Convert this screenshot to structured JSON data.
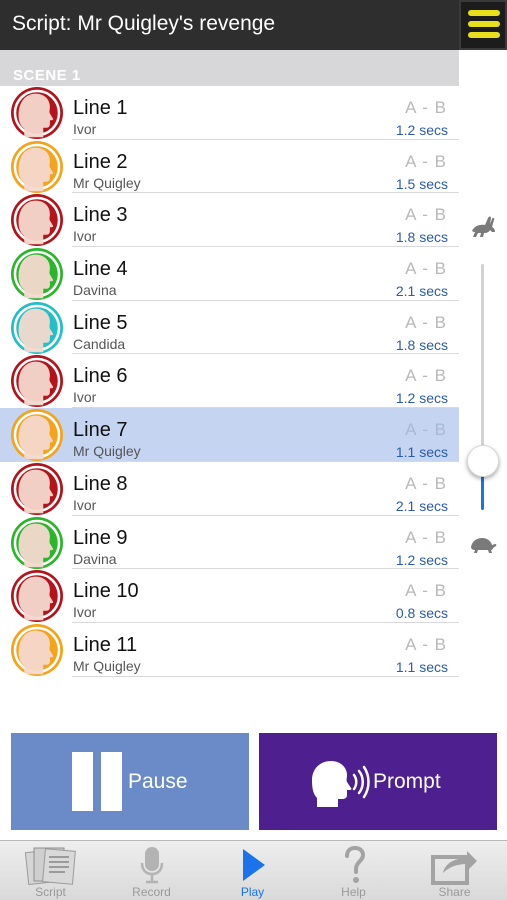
{
  "header": {
    "title": "Script:  Mr Quigley's revenge",
    "menu_icon": "hamburger-menu-icon",
    "menu_color": "#e9e01d"
  },
  "scene": {
    "label": "SCENE 1"
  },
  "speakers": {
    "Ivor": "#b3141b",
    "Mr Quigley": "#f4a31c",
    "Davina": "#2bb52b",
    "Candida": "#23bfc7"
  },
  "lines": [
    {
      "title": "Line 1",
      "speaker": "Ivor",
      "ab": "A  -  B",
      "duration": "1.2 secs"
    },
    {
      "title": "Line 2",
      "speaker": "Mr Quigley",
      "ab": "A  -  B",
      "duration": "1.5 secs"
    },
    {
      "title": "Line 3",
      "speaker": "Ivor",
      "ab": "A  -  B",
      "duration": "1.8 secs"
    },
    {
      "title": "Line 4",
      "speaker": "Davina",
      "ab": "A  -  B",
      "duration": "2.1 secs"
    },
    {
      "title": "Line 5",
      "speaker": "Candida",
      "ab": "A  -  B",
      "duration": "1.8 secs"
    },
    {
      "title": "Line 6",
      "speaker": "Ivor",
      "ab": "A  -  B",
      "duration": "1.2 secs"
    },
    {
      "title": "Line 7",
      "speaker": "Mr Quigley",
      "ab": "A  -  B",
      "duration": "1.1 secs",
      "selected": true
    },
    {
      "title": "Line 8",
      "speaker": "Ivor",
      "ab": "A  -  B",
      "duration": "2.1 secs"
    },
    {
      "title": "Line 9",
      "speaker": "Davina",
      "ab": "A  -  B",
      "duration": "1.2 secs"
    },
    {
      "title": "Line 10",
      "speaker": "Ivor",
      "ab": "A  -  B",
      "duration": "0.8 secs"
    },
    {
      "title": "Line 11",
      "speaker": "Mr Quigley",
      "ab": "A  -  B",
      "duration": "1.1 secs"
    }
  ],
  "speed_slider": {
    "fast_icon": "rabbit-icon",
    "slow_icon": "turtle-icon",
    "level": 0.2
  },
  "controls": {
    "pause_label": "Pause",
    "pause_icon": "pause-icon",
    "pause_color": "#6a8bc8",
    "prompt_label": "Prompt",
    "prompt_icon": "speaking-head-icon",
    "prompt_color": "#4d1f8f"
  },
  "tabs": [
    {
      "label": "Script",
      "icon": "script-pages-icon",
      "active": false
    },
    {
      "label": "Record",
      "icon": "microphone-icon",
      "active": false
    },
    {
      "label": "Play",
      "icon": "play-icon",
      "active": true
    },
    {
      "label": "Help",
      "icon": "question-mark-icon",
      "active": false
    },
    {
      "label": "Share",
      "icon": "share-icon",
      "active": false
    }
  ]
}
